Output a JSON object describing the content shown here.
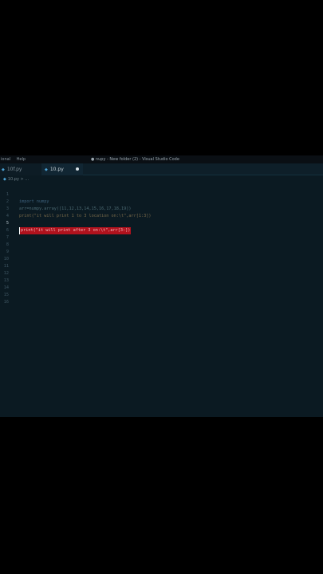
{
  "window": {
    "menu": [
      "ional",
      "Help"
    ],
    "title": "● nupy - New folder (2) - Visual Studio Code"
  },
  "tabs": [
    {
      "label": "10f.py",
      "icon": "python-file-icon",
      "active": false
    },
    {
      "label": "10.py",
      "icon": "python-file-icon",
      "active": true,
      "unsaved": true
    }
  ],
  "breadcrumb": "10.py > ...",
  "editor": {
    "lines": [
      {
        "number": "1",
        "code": "import numpy"
      },
      {
        "number": "2",
        "code": "arr=numpy.array([11,12,13,14,15,16,17,18,19])"
      },
      {
        "number": "3",
        "code": "print(\"it will print 1 to 3 location on:\\t\",arr[1:3])"
      },
      {
        "number": "4",
        "code": ""
      },
      {
        "number": "5",
        "code": "print(\"it will print after 3 on:\\t\",arr[3:])"
      },
      {
        "number": "6",
        "code": ""
      },
      {
        "number": "7",
        "code": ""
      },
      {
        "number": "8",
        "code": ""
      },
      {
        "number": "9",
        "code": ""
      },
      {
        "number": "10",
        "code": ""
      },
      {
        "number": "11",
        "code": ""
      },
      {
        "number": "12",
        "code": ""
      },
      {
        "number": "13",
        "code": ""
      },
      {
        "number": "14",
        "code": ""
      },
      {
        "number": "15",
        "code": ""
      },
      {
        "number": "16",
        "code": ""
      }
    ],
    "active_line": 5
  },
  "colors": {
    "editor_bg": "#0b1a22",
    "selection": "#b0121d",
    "page_bg": "#000000"
  }
}
